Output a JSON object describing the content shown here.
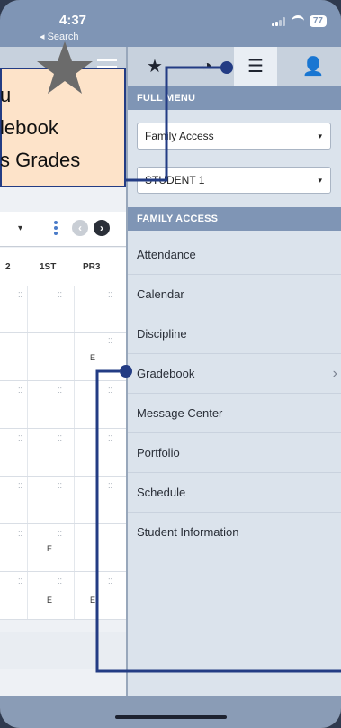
{
  "status_bar": {
    "time": "4:37",
    "back_label": "◂ Search",
    "battery": "77"
  },
  "left_page": {
    "columns": [
      "2",
      "1ST",
      "PR3"
    ],
    "rows": [
      {
        "c1": "",
        "c2": "",
        "c3": ""
      },
      {
        "c1": "",
        "c2": "",
        "c3": "E"
      },
      {
        "c1": "",
        "c2": "",
        "c3": ""
      },
      {
        "c1": "",
        "c2": "",
        "c3": ""
      },
      {
        "c1": "",
        "c2": "",
        "c3": ""
      },
      {
        "c1": "",
        "c2": "E",
        "c3": ""
      },
      {
        "c1": "",
        "c2": "E",
        "c3": "E"
      }
    ]
  },
  "menu": {
    "tabs": [
      {
        "icon": "star-icon"
      },
      {
        "icon": "clock-icon"
      },
      {
        "icon": "list-icon",
        "active": true
      },
      {
        "icon": "person-icon"
      }
    ],
    "full_menu_label": "FULL MENU",
    "access_select": "Family Access",
    "student_select": "STUDENT 1",
    "family_access_label": "FAMILY ACCESS",
    "items": [
      "Attendance",
      "Calendar",
      "Discipline",
      "Gradebook",
      "Message Center",
      "Portfolio",
      "Schedule",
      "Student Information"
    ]
  },
  "annotation": {
    "lines": [
      "u",
      "lebook",
      "s Grades"
    ],
    "colors": {
      "box_bg": "#fde3c9",
      "line": "#233c84",
      "star": "#6b6b6b"
    }
  }
}
